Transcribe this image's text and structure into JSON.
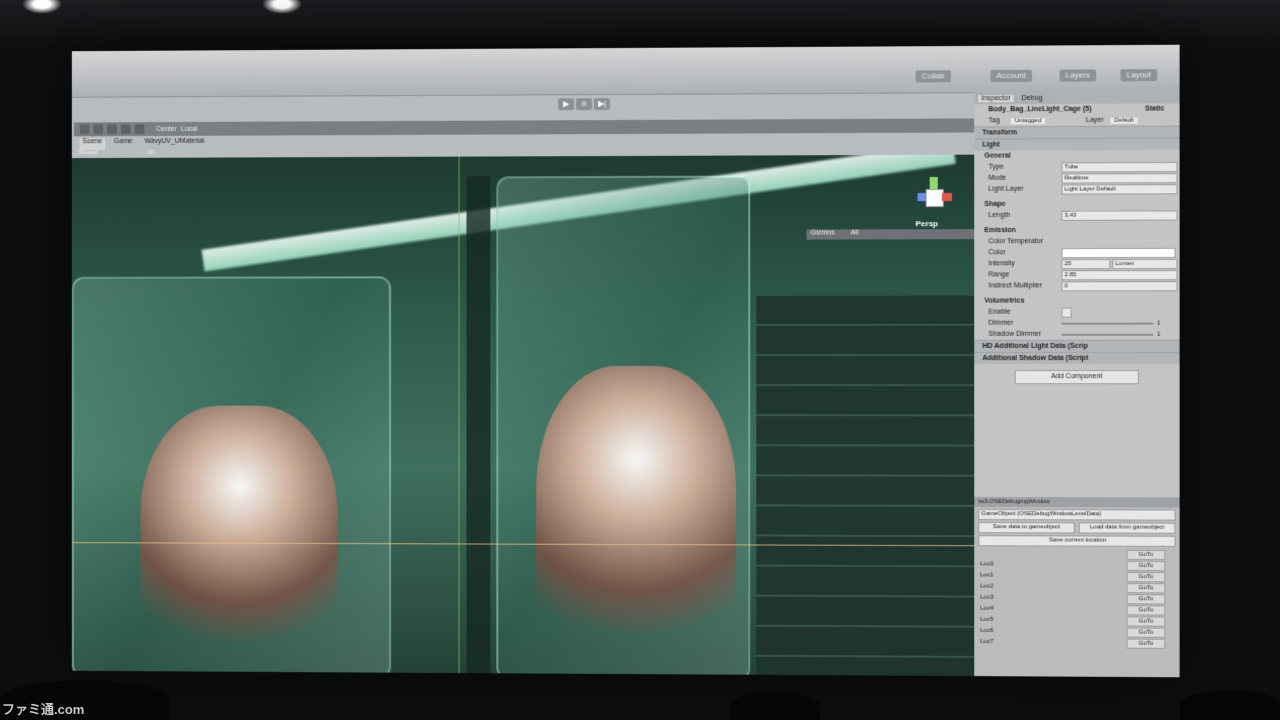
{
  "editor": {
    "play_buttons": [
      "▶",
      "II",
      "▶|"
    ],
    "top_buttons": {
      "collab": "Collab",
      "account": "Account",
      "layers": "Layers",
      "layout": "Layout"
    },
    "scene_toolbar": {
      "center": "Center",
      "local": "Local",
      "gizmos": "Gizmos",
      "search": "All"
    },
    "tabs": [
      "Scene",
      "Game",
      "WavyUV_UMaterial"
    ],
    "shading": {
      "mode": "Shaded",
      "dim": "2D"
    },
    "persp_label": "Persp"
  },
  "inspector": {
    "tabs": [
      "Inspector",
      "Debug"
    ],
    "object_name": "Body_Bag_LineLight_Cage (5)",
    "static_label": "Static",
    "tag_label": "Tag",
    "tag_value": "Untagged",
    "layer_label": "Layer",
    "layer_value": "Default",
    "components": {
      "transform": "Transform",
      "light": "Light",
      "hd_light": "HD Additional Light Data (Scrip",
      "shadow": "Additional Shadow Data (Script"
    },
    "general": {
      "title": "General",
      "rows": [
        {
          "label": "Type",
          "value": "Tube"
        },
        {
          "label": "Mode",
          "value": "Realtime"
        },
        {
          "label": "Light Layer",
          "value": "Light Layer Default"
        }
      ]
    },
    "shape": {
      "title": "Shape",
      "length_label": "Length",
      "length_value": "3.43"
    },
    "emission": {
      "title": "Emission",
      "color_temp_label": "Color Temperatur",
      "color_label": "Color",
      "intensity_label": "Intensity",
      "intensity_value": "25",
      "intensity_unit": "Lumen",
      "range_label": "Range",
      "range_value": "2.85",
      "indirect_label": "Indirect Multiplier",
      "indirect_value": "0"
    },
    "volumetrics": {
      "title": "Volumetrics",
      "enable_label": "Enable",
      "dimmer_label": "Dimmer",
      "dimmer_value": "1",
      "shadow_dimmer_label": "Shadow Dimmer",
      "shadow_dimmer_value": "1"
    },
    "add_component": "Add Component"
  },
  "debug_window": {
    "title": "ss3.OSEDebugingWindow",
    "object_field": "GameObject (OSEDebugWindowLevelData)",
    "save_btn": "Save data to gameobject",
    "load_btn": "Load data from gameobject",
    "save_loc_btn": "Save current location",
    "goto_label": "GoTo",
    "locations": [
      "Loc0",
      "Loc1",
      "Loc2",
      "Loc3",
      "Loc4",
      "Loc5",
      "Loc6",
      "Loc7"
    ]
  },
  "watermark": "ファミ通.com"
}
